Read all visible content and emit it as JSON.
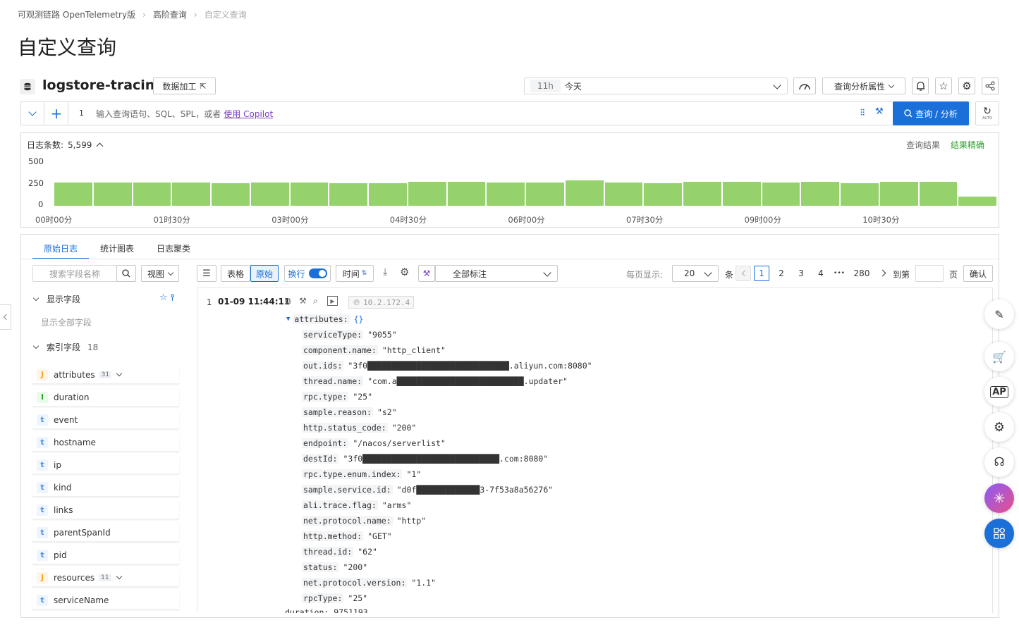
{
  "breadcrumb": [
    "可观测链路 OpenTelemetry版",
    "高阶查询",
    "自定义查询"
  ],
  "page_title": "自定义查询",
  "logstore": {
    "name": "logstore-tracing",
    "data_process_label": "数据加工"
  },
  "time_picker": {
    "short": "11h",
    "label": "今天"
  },
  "analysis_props_label": "查询分析属性",
  "query": {
    "line_number": "1",
    "placeholder": "输入查询语句、SQL、SPL，或者",
    "copilot_link": "使用 Copilot",
    "search_button": "查询 / 分析",
    "auto_label": "AUTO"
  },
  "histogram": {
    "count_label": "日志条数:",
    "count_value": "5,599",
    "result_label": "查询结果",
    "accuracy_label": "结果精确",
    "y_ticks": [
      "500",
      "250",
      "0"
    ],
    "x_ticks": [
      "00时00分",
      "01时30分",
      "03时00分",
      "04时30分",
      "06时00分",
      "07时30分",
      "09时00分",
      "10时30分"
    ],
    "bar_color": "#95d26b"
  },
  "chart_data": {
    "type": "bar",
    "title": "",
    "ylabel": "",
    "xlabel": "",
    "ylim": [
      0,
      500
    ],
    "values": [
      265,
      265,
      265,
      265,
      262,
      265,
      265,
      262,
      262,
      275,
      275,
      265,
      265,
      290,
      268,
      262,
      275,
      275,
      268,
      275,
      262,
      275,
      275,
      105
    ],
    "x_ticks": [
      "00时00分",
      "01时30分",
      "03时00分",
      "04时30分",
      "06时00分",
      "07时30分",
      "09时00分",
      "10时30分"
    ]
  },
  "tabs": [
    "原始日志",
    "统计图表",
    "日志聚类"
  ],
  "sidebar": {
    "search_placeholder": "搜索字段名称",
    "view_label": "视图",
    "display_fields_label": "显示字段",
    "show_all_label": "显示全部字段",
    "index_fields_label": "索引字段",
    "index_fields_count": "18",
    "fields": [
      {
        "type": "J",
        "name": "attributes",
        "count": "31",
        "expandable": true
      },
      {
        "type": "l",
        "name": "duration",
        "count": "",
        "expandable": false
      },
      {
        "type": "t",
        "name": "event",
        "count": "",
        "expandable": false
      },
      {
        "type": "t",
        "name": "hostname",
        "count": "",
        "expandable": false
      },
      {
        "type": "t",
        "name": "ip",
        "count": "",
        "expandable": false
      },
      {
        "type": "t",
        "name": "kind",
        "count": "",
        "expandable": false
      },
      {
        "type": "t",
        "name": "links",
        "count": "",
        "expandable": false
      },
      {
        "type": "t",
        "name": "parentSpanId",
        "count": "",
        "expandable": false
      },
      {
        "type": "t",
        "name": "pid",
        "count": "",
        "expandable": false
      },
      {
        "type": "J",
        "name": "resources",
        "count": "11",
        "expandable": true
      },
      {
        "type": "t",
        "name": "serviceName",
        "count": "",
        "expandable": false
      }
    ]
  },
  "toolbar": {
    "table_label": "表格",
    "raw_label": "原始",
    "wrap_label": "换行",
    "time_label": "时间",
    "annotation_label": "全部标注",
    "per_page_label": "每页显示:",
    "per_page_value": "20",
    "unit_label": "条",
    "pages": [
      "1",
      "2",
      "3",
      "4",
      "•••",
      "280"
    ],
    "goto_label": "到第",
    "page_unit": "页",
    "confirm_label": "确认"
  },
  "log": {
    "index": "1",
    "time": "01-09 11:44:11",
    "source_ip": "10.2.172.4",
    "attributes_key": "attributes:",
    "attributes_brace": "{}",
    "entries": [
      {
        "k": "serviceType:",
        "v": "\"9055\""
      },
      {
        "k": "component.name:",
        "v": "\"http_client\""
      },
      {
        "k": "out.ids:",
        "v": "\"3f0█████████████████████████████.aliyun.com:8080\""
      },
      {
        "k": "thread.name:",
        "v": "\"com.a██████████████████████████.updater\""
      },
      {
        "k": "rpc.type:",
        "v": "\"25\""
      },
      {
        "k": "sample.reason:",
        "v": "\"s2\""
      },
      {
        "k": "http.status_code:",
        "v": "\"200\""
      },
      {
        "k": "endpoint:",
        "v": "\"/nacos/serverlist\""
      },
      {
        "k": "destId:",
        "v": "\"3f0████████████████████████████.com:8080\""
      },
      {
        "k": "rpc.type.enum.index:",
        "v": "\"1\""
      },
      {
        "k": "sample.service.id:",
        "v": "\"d0f█████████████3-7f53a8a56276\""
      },
      {
        "k": "ali.trace.flag:",
        "v": "\"arms\""
      },
      {
        "k": "net.protocol.name:",
        "v": "\"http\""
      },
      {
        "k": "http.method:",
        "v": "\"GET\""
      },
      {
        "k": "thread.id:",
        "v": "\"62\""
      },
      {
        "k": "status:",
        "v": "\"200\""
      },
      {
        "k": "net.protocol.version:",
        "v": "\"1.1\""
      },
      {
        "k": "rpcType:",
        "v": "\"25\""
      }
    ],
    "trailing": "duration: 9751193"
  }
}
